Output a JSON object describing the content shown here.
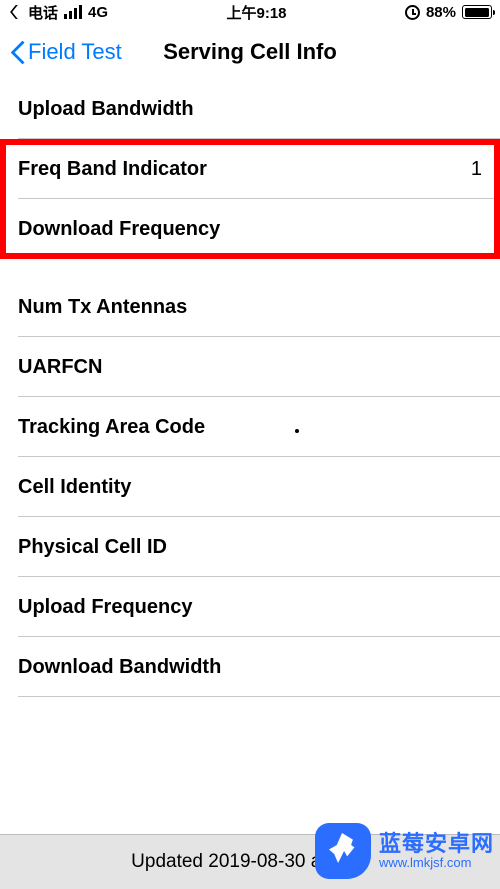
{
  "status_bar": {
    "carrier": "电话",
    "network": "4G",
    "time": "上午9:18",
    "battery_percent": "88%"
  },
  "nav": {
    "back_label": "Field Test",
    "title": "Serving Cell Info"
  },
  "rows": [
    {
      "label": "Upload Bandwidth",
      "value": ""
    },
    {
      "label": "Freq Band Indicator",
      "value": "1"
    },
    {
      "label": "Download Frequency",
      "value": ""
    },
    {
      "label": "Num Tx Antennas",
      "value": ""
    },
    {
      "label": "UARFCN",
      "value": ""
    },
    {
      "label": "Tracking Area Code",
      "value": ""
    },
    {
      "label": "Cell Identity",
      "value": ""
    },
    {
      "label": "Physical Cell ID",
      "value": ""
    },
    {
      "label": "Upload Frequency",
      "value": ""
    },
    {
      "label": "Download Bandwidth",
      "value": ""
    }
  ],
  "footer": {
    "updated": "Updated 2019-08-30 at 09:1"
  },
  "watermark": {
    "title": "蓝莓安卓网",
    "url": "www.lmkjsf.com"
  }
}
